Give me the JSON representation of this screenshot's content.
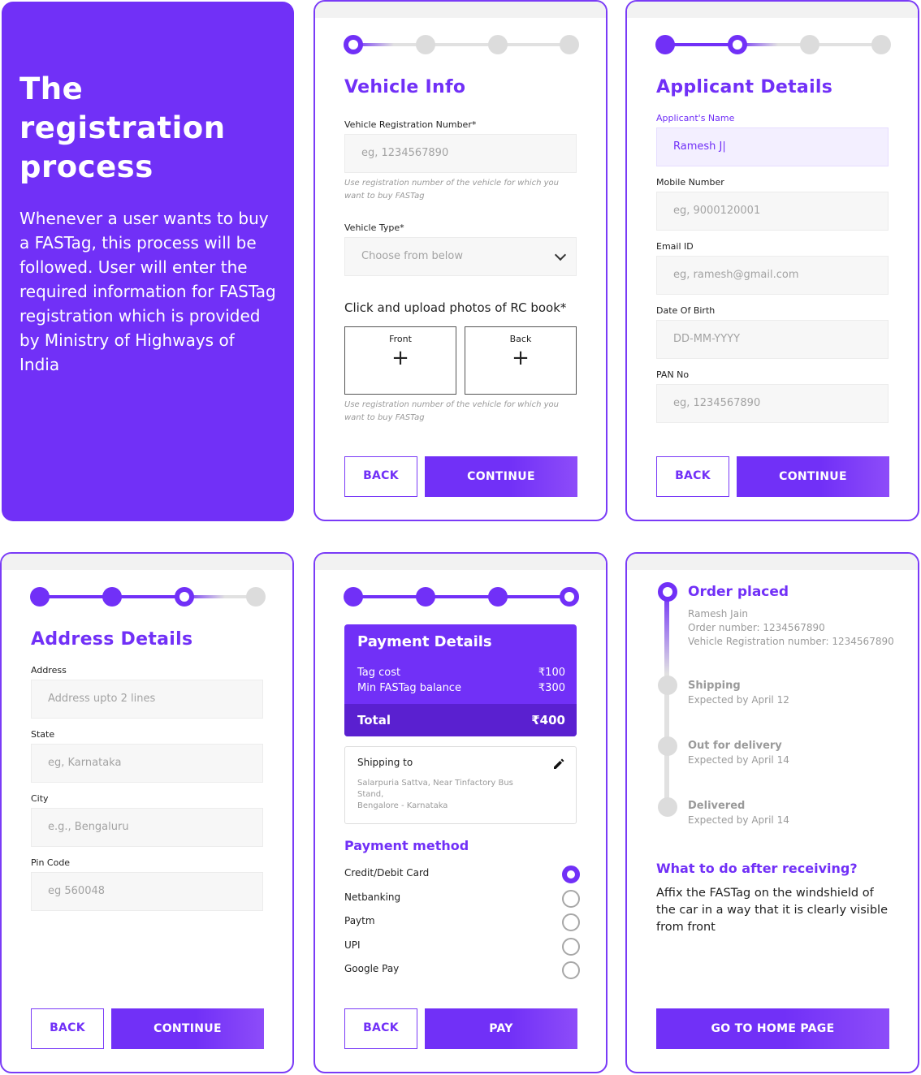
{
  "intro": {
    "title": "The registration process",
    "body": "Whenever a user wants to buy a FASTag, this process will be followed. User will enter the required information for FASTag registration which is provided by Ministry of Highways of India"
  },
  "vehicle_info": {
    "title": "Vehicle Info",
    "reg_label": "Vehicle Registration Number*",
    "reg_placeholder": "eg, 1234567890",
    "reg_hint": "Use registration number of the vehicle for which you want to buy FASTag",
    "type_label": "Vehicle Type*",
    "type_value": "Choose from below",
    "upload_title": "Click and upload photos of RC book*",
    "front_label": "Front",
    "back_label": "Back",
    "plus": "+",
    "upload_hint": "Use registration number of the vehicle for which you want to buy FASTag",
    "back_button": "BACK",
    "continue_button": "CONTINUE"
  },
  "applicant": {
    "title": "Applicant Details",
    "name_label": "Applicant's Name",
    "name_value": "Ramesh J|",
    "mobile_label": "Mobile Number",
    "mobile_placeholder": "eg, 9000120001",
    "email_label": "Email ID",
    "email_placeholder": "eg, ramesh@gmail.com",
    "dob_label": "Date Of Birth",
    "dob_placeholder": "DD-MM-YYYY",
    "pan_label": "PAN No",
    "pan_placeholder": "eg, 1234567890",
    "back_button": "BACK",
    "continue_button": "CONTINUE"
  },
  "address": {
    "title": "Address Details",
    "address_label": "Address",
    "address_placeholder": "Address upto 2 lines",
    "state_label": "State",
    "state_placeholder": "eg, Karnataka",
    "city_label": "City",
    "city_placeholder": "e.g., Bengaluru",
    "pin_label": "Pin Code",
    "pin_placeholder": "eg 560048",
    "back_button": "BACK",
    "continue_button": "CONTINUE"
  },
  "payment": {
    "title": "Payment Details",
    "tag_cost_label": "Tag cost",
    "tag_cost_value": "₹100",
    "min_balance_label": "Min FASTag balance",
    "min_balance_value": "₹300",
    "total_label": "Total",
    "total_value": "₹400",
    "shipping_title": "Shipping to",
    "shipping_address": "Salarpuria Sattva, Near Tinfactory Bus Stand,\nBengalore - Karnataka",
    "method_title": "Payment method",
    "methods": [
      {
        "label": "Credit/Debit Card",
        "selected": true
      },
      {
        "label": "Netbanking",
        "selected": false
      },
      {
        "label": "Paytm",
        "selected": false
      },
      {
        "label": "UPI",
        "selected": false
      },
      {
        "label": "Google Pay",
        "selected": false
      }
    ],
    "back_button": "BACK",
    "pay_button": "PAY"
  },
  "order": {
    "steps": [
      {
        "title": "Order placed",
        "lines": [
          "Ramesh Jain",
          "Order number: 1234567890",
          "Vehicle Registration number: 1234567890"
        ]
      },
      {
        "title": "Shipping",
        "lines": [
          "Expected by April 12"
        ]
      },
      {
        "title": "Out for delivery",
        "lines": [
          "Expected by April 14"
        ]
      },
      {
        "title": "Delivered",
        "lines": [
          "Expected by April 14"
        ]
      }
    ],
    "after_title": "What to do after receiving?",
    "after_text": "Affix the FASTag on the windshield of the car in a way that it is clearly visible from front",
    "home_button": "GO TO HOME PAGE"
  },
  "colors": {
    "accent": "#7130f7",
    "accent_dark": "#5a20d0",
    "field_bg": "#f7f7f7",
    "inactive_step": "#dcdcdc"
  }
}
